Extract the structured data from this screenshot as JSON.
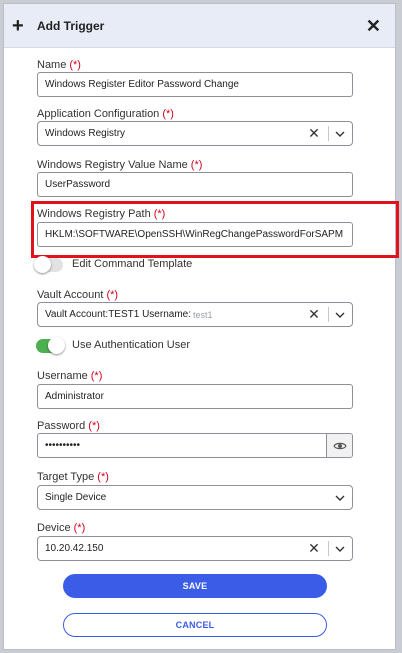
{
  "dialog": {
    "title": "Add Trigger",
    "required_marker": "(*)"
  },
  "fields": {
    "name": {
      "label": "Name",
      "value": "Windows Register Editor Password Change"
    },
    "app_config": {
      "label": "Application Configuration",
      "value": "Windows Registry"
    },
    "value_name": {
      "label": "Windows Registry Value Name",
      "value": "UserPassword"
    },
    "reg_path": {
      "label": "Windows Registry Path",
      "value": "HKLM:\\SOFTWARE\\OpenSSH\\WinRegChangePasswordForSAPM"
    },
    "edit_cmd": {
      "label": "Edit Command Template",
      "on": false
    },
    "vault": {
      "label": "Vault Account",
      "value": "Vault Account:TEST1 Username:",
      "value_suffix": "test1"
    },
    "use_auth": {
      "label": "Use Authentication User",
      "on": true
    },
    "username": {
      "label": "Username",
      "value": "Administrator"
    },
    "password": {
      "label": "Password",
      "value": "••••••••••"
    },
    "target_type": {
      "label": "Target Type",
      "value": "Single Device"
    },
    "device": {
      "label": "Device",
      "value": "10.20.42.150"
    }
  },
  "buttons": {
    "save": "SAVE",
    "cancel": "CANCEL"
  },
  "colors": {
    "accent": "#3b5ce6",
    "required": "#d0021b",
    "highlight": "#e0121c",
    "toggle_on": "#4caf50"
  }
}
